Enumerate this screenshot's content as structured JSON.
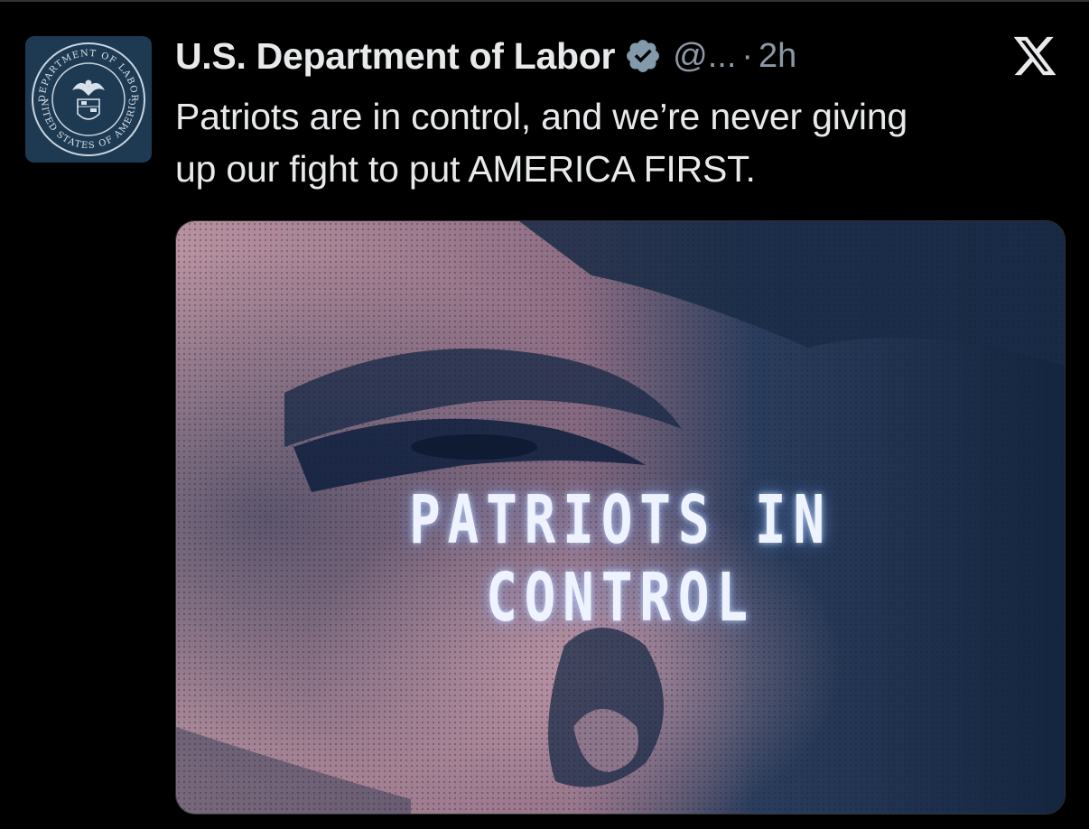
{
  "tweet": {
    "author": {
      "display_name": "U.S. Department of Labor",
      "verified_icon": "verified-badge-icon",
      "handle": "@...",
      "avatar_seal_top_text": "DEPARTMENT OF LABOR",
      "avatar_seal_bottom_text": "UNITED STATES OF AMERICA"
    },
    "separator": "·",
    "time": "2h",
    "platform_icon": "x-logo-icon",
    "text_line_1": "Patriots are in control, and we’re never giving",
    "text_line_2": "up our fight to put AMERICA FIRST.",
    "media": {
      "caption": "PATRIOTS IN CONTROL"
    }
  },
  "colors": {
    "background": "#000000",
    "primary_text": "#e7e9ea",
    "secondary_text": "#8b98a5",
    "avatar_bg": "#1e3a52",
    "verified_badge": "#829aab",
    "media_pink": "#b58a9e",
    "media_navy": "#14253f"
  }
}
